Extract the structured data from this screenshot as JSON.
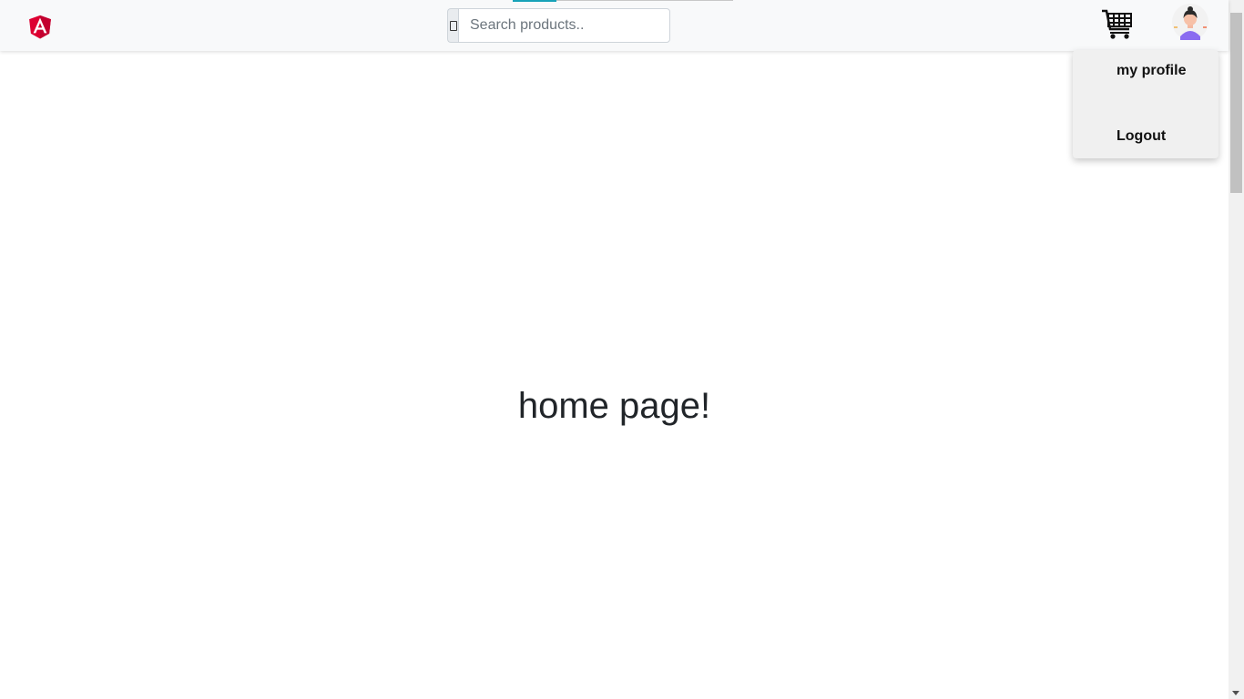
{
  "navbar": {
    "logo_icon": "angular-logo-icon",
    "search": {
      "placeholder": "Search products..",
      "value": "",
      "icon": "search-icon"
    },
    "cart_icon": "shopping-cart-icon",
    "avatar_icon": "user-avatar-icon"
  },
  "dropdown": {
    "items": [
      {
        "label": "my profile"
      },
      {
        "label": "Logout"
      }
    ]
  },
  "main": {
    "heading": "home page!"
  },
  "colors": {
    "logo": "#dd0031",
    "navbar_bg": "#f8f9fa",
    "dropdown_bg": "#f0f0f0",
    "accent": "#17a2b8"
  }
}
